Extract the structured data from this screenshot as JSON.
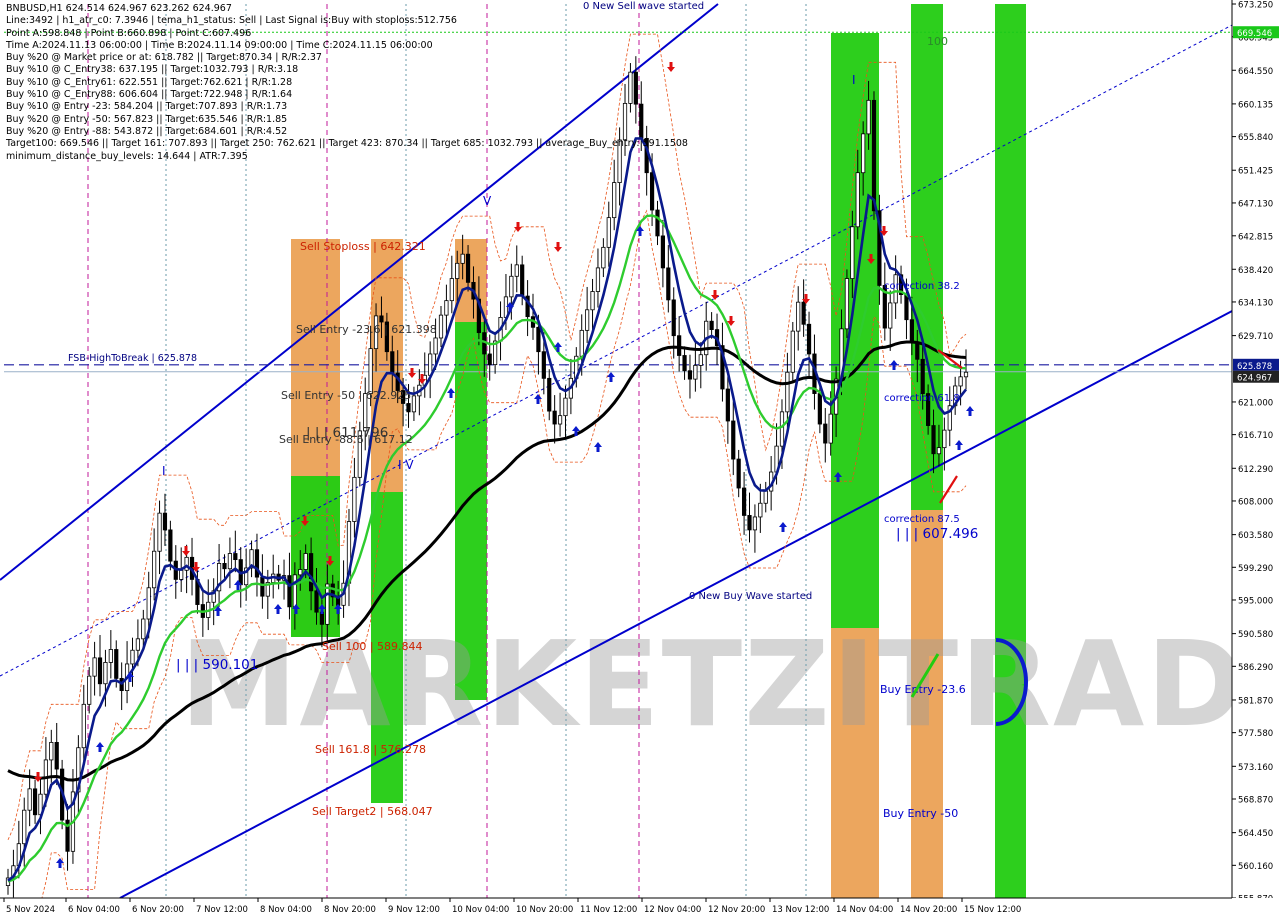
{
  "info_panel": {
    "lines": [
      "BNBUSD,H1  624.514 624.967 623.262 624.967",
      "Line:3492  | h1_atr_c0: 7.3946  | tema_h1_status: Sell  | Last Signal is:Buy with stoploss:512.756",
      "Point A:598.848  | Point B:660.898  | Point C:607.496",
      "Time A:2024.11.13 06:00:00  | Time B:2024.11.14 09:00:00  | Time C:2024.11.15 06:00:00",
      "Buy %20 @ Market price or at: 618.782  || Target:870.34  | R/R:2.37",
      "Buy %10 @ C_Entry38: 637.195  || Target:1032.793  | R/R:3.18",
      "Buy %10 @ C_Entry61: 622.551  || Target:762.621  | R/R:1.28",
      "Buy %10 @ C_Entry88: 606.604  || Target:722.948  | R/R:1.64",
      "Buy %10 @ Entry -23: 584.204  || Target:707.893  | R/R:1.73",
      "Buy %20 @ Entry -50: 567.823  || Target:635.546  | R/R:1.85",
      "Buy %20 @ Entry -88: 543.872  || Target:684.601  | R/R:4.52",
      "Target100: 669.546  || Target 161: 707.893  || Target 250: 762.621  || Target 423: 870.34  || Target 685: 1032.793  || average_Buy_entry: 591.1508",
      "minimum_distance_buy_levels: 14.644  | ATR:7.395"
    ]
  },
  "watermark": "MARKETZITRADE",
  "colors": {
    "bull_candle": "#000000",
    "bear_candle": "#000000",
    "ema_fast": "#0a1a8c",
    "ema_mid": "#2ecc2e",
    "ema_slow": "#000000",
    "channel": "#0000cc",
    "sell_zone": "#e8923a",
    "buy_zone": "#22cc11",
    "sell_text": "#cc2200",
    "buy_text": "#0000cc",
    "price_line": "#1a1aa0",
    "current_price_bg": "#0a1a8c",
    "target_bg": "#19c819",
    "grid_vline_magenta": "#c0189a",
    "grid_vline_slate": "#6a9aaa"
  },
  "chart_data": {
    "type": "candlestick",
    "symbol": "BNBUSD",
    "timeframe": "H1",
    "ylim": [
      555.87,
      673.25
    ],
    "y_ticks": [
      "673.250",
      "668.945",
      "664.550",
      "660.135",
      "655.840",
      "651.425",
      "647.130",
      "642.815",
      "638.420",
      "634.130",
      "629.710",
      "625.878",
      "624.967",
      "621.000",
      "616.710",
      "612.290",
      "608.000",
      "603.580",
      "599.290",
      "595.000",
      "590.580",
      "586.290",
      "581.870",
      "577.580",
      "573.160",
      "568.870",
      "564.450",
      "560.160",
      "555.870"
    ],
    "x_ticks": [
      "5 Nov 2024",
      "6 Nov 04:00",
      "6 Nov 20:00",
      "7 Nov 12:00",
      "8 Nov 04:00",
      "8 Nov 20:00",
      "9 Nov 12:00",
      "10 Nov 04:00",
      "10 Nov 20:00",
      "11 Nov 12:00",
      "12 Nov 04:00",
      "12 Nov 20:00",
      "13 Nov 12:00",
      "14 Nov 04:00",
      "14 Nov 20:00",
      "15 Nov 12:00"
    ],
    "current_price": 624.967,
    "price_line_label": "625.878",
    "target_price_label": "669.546",
    "ohlc_last": {
      "open": 624.514,
      "high": 624.967,
      "low": 623.262,
      "close": 624.967
    },
    "levels": {
      "fsb_high_to_break": {
        "label": "FSB-HighToBreak | 625.878",
        "value": 625.878
      },
      "target100_line": 669.546
    },
    "zone_labels": {
      "sell_stoploss": "Sell Stoploss | 642.321",
      "sell_entry_23": "Sell Entry -23.6 | 621.398",
      "sell_entry_50": "Sell Entry -50 | 622.925",
      "sell_entry_88": "Sell Entry -88.6 | 617.12",
      "sell_611": "| | | 611.796",
      "sell_100": "Sell 100 | 589.844",
      "sell_1618": "Sell 161.8 | 576.278",
      "sell_target2": "Sell Target2 | 568.047",
      "buy_590": "| | | 590.101",
      "buy_607": "| | | 607.496",
      "correction_382": "correction 38.2",
      "correction_618": "correction 61.8",
      "correction_875": "correction 87.5",
      "buy_entry_236": "Buy Entry -23.6",
      "buy_entry_50": "Buy Entry -50",
      "label_100": "100",
      "new_sell_wave": "0 New Sell wave started",
      "new_buy_wave": "0 New Buy Wave started",
      "marker_v": "V",
      "marker_i1": "I",
      "marker_i2": "I",
      "marker_iv": "I V"
    },
    "candles_close": [
      558.5,
      560.1,
      563.0,
      567.4,
      570.2,
      566.8,
      569.5,
      574.0,
      576.3,
      572.8,
      566.1,
      562.0,
      569.8,
      575.6,
      581.3,
      585.0,
      587.4,
      584.0,
      586.8,
      588.5,
      584.7,
      583.1,
      586.6,
      588.4,
      589.9,
      592.5,
      596.6,
      601.4,
      606.4,
      604.2,
      600.1,
      597.7,
      598.9,
      600.6,
      597.7,
      594.4,
      592.7,
      594.7,
      596.2,
      599.8,
      599.1,
      601.1,
      600.3,
      597.0,
      599.2,
      601.6,
      598.0,
      595.5,
      597.3,
      598.4,
      597.6,
      598.2,
      594.1,
      598.3,
      599.0,
      601.1,
      596.2,
      593.4,
      591.8,
      597.1,
      595.4,
      594.3,
      597.2,
      605.3,
      611.1,
      617.2,
      622.1,
      628.0,
      632.3,
      631.5,
      627.6,
      624.8,
      622.5,
      620.8,
      619.7,
      621.8,
      623.2,
      624.5,
      627.3,
      629.4,
      632.4,
      634.3,
      637.2,
      639.2,
      640.4,
      636.7,
      634.5,
      630.1,
      627.3,
      625.9,
      629.0,
      632.1,
      634.8,
      637.5,
      639.0,
      634.9,
      632.2,
      630.8,
      627.6,
      624.1,
      619.8,
      618.1,
      619.2,
      621.5,
      624.1,
      627.0,
      630.4,
      633.1,
      635.5,
      638.6,
      641.3,
      645.2,
      649.8,
      655.4,
      660.2,
      664.3,
      660.1,
      655.6,
      651.1,
      646.2,
      642.8,
      638.6,
      634.4,
      629.7,
      627.1,
      625.1,
      624.0,
      625.8,
      627.2,
      631.6,
      630.5,
      628.4,
      622.7,
      618.5,
      613.5,
      609.7,
      606.1,
      604.2,
      605.9,
      607.7,
      609.3,
      611.8,
      615.2,
      619.7,
      624.9,
      630.3,
      634.1,
      631.2,
      627.3,
      622.1,
      618.1,
      615.6,
      619.4,
      624.0,
      630.6,
      637.2,
      644.0,
      651.1,
      656.2,
      660.6,
      646.1,
      636.3,
      630.7,
      634.0,
      637.7,
      635.1,
      631.8,
      628.8,
      626.6,
      622.1,
      617.9,
      614.2,
      615.0,
      617.3,
      620.5,
      623.1,
      624.3,
      624.9
    ]
  }
}
